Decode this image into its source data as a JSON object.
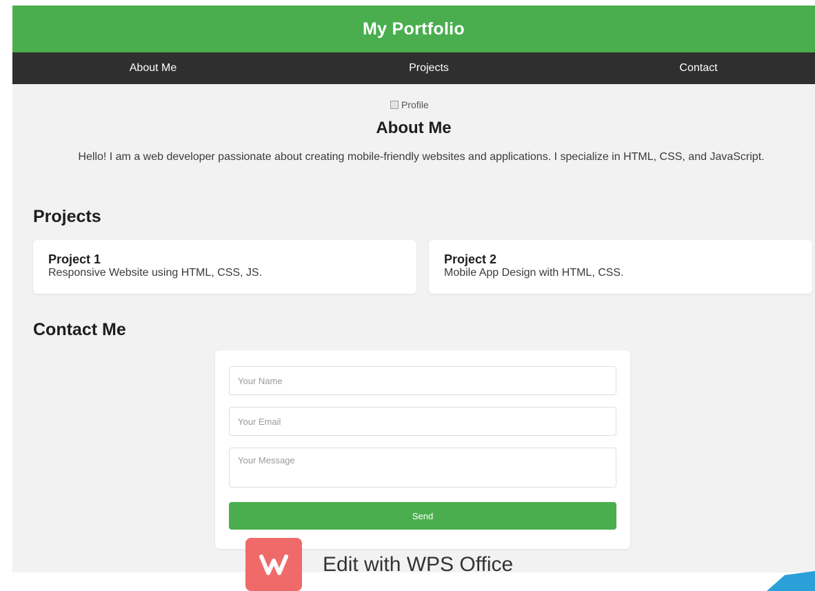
{
  "header": {
    "title": "My Portfolio"
  },
  "nav": {
    "items": [
      {
        "label": "About Me"
      },
      {
        "label": "Projects"
      },
      {
        "label": "Contact"
      }
    ]
  },
  "about": {
    "image_alt": "Profile",
    "title": "About Me",
    "text": "Hello! I am a web developer passionate about creating mobile-friendly websites and applications. I specialize in HTML, CSS, and JavaScript."
  },
  "projects": {
    "title": "Projects",
    "items": [
      {
        "name": "Project 1",
        "description": "Responsive Website using HTML, CSS, JS."
      },
      {
        "name": "Project 2",
        "description": "Mobile App Design with HTML, CSS."
      }
    ]
  },
  "contact": {
    "title": "Contact Me",
    "name_placeholder": "Your Name",
    "email_placeholder": "Your Email",
    "message_placeholder": "Your Message",
    "send_label": "Send"
  },
  "watermark": {
    "label": "Edit with WPS Office",
    "logo_icon": "wps-logo-icon"
  },
  "colors": {
    "header_green": "#4aae4f",
    "nav_dark": "#2f2f2f",
    "page_bg": "#f2f2f2",
    "wps_red": "#f06a6a"
  }
}
